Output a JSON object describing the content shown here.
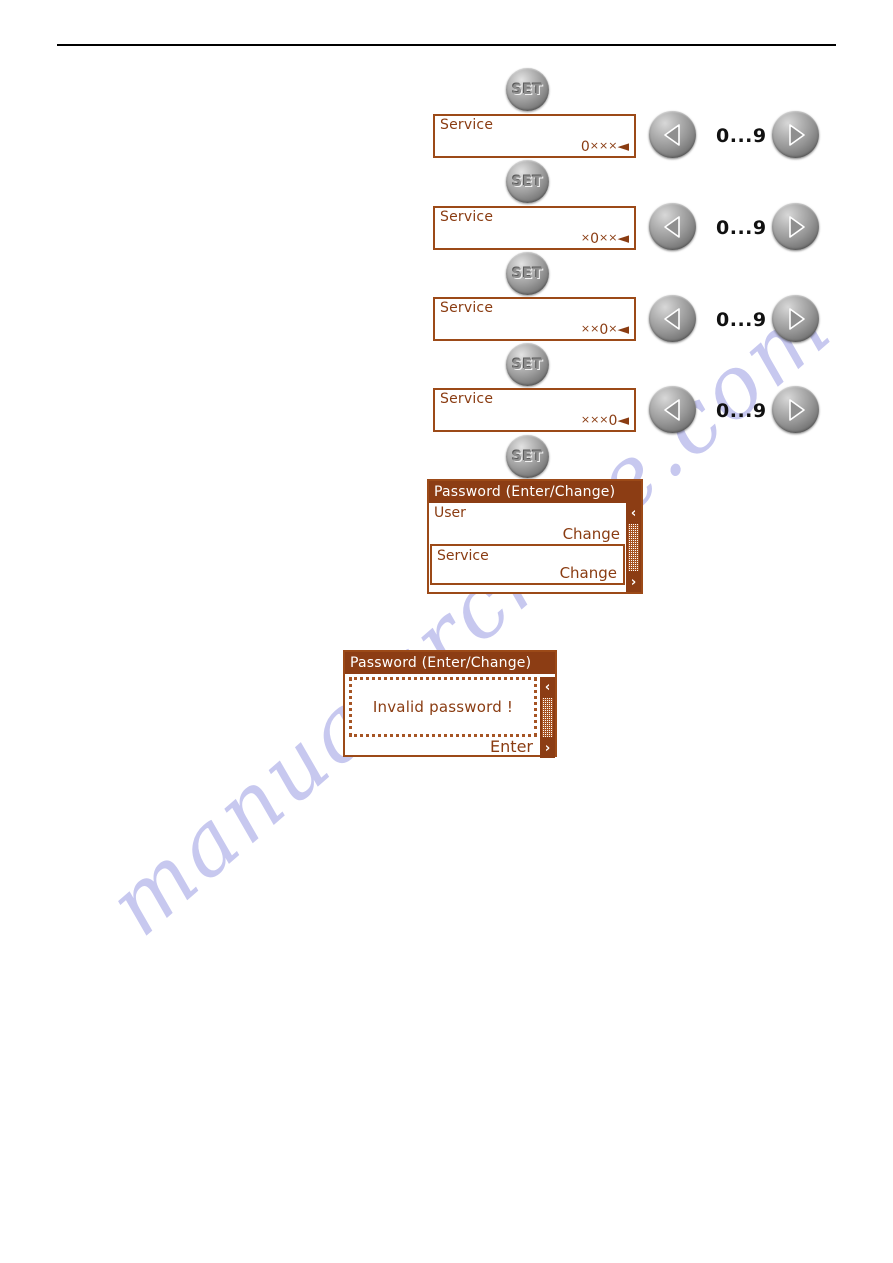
{
  "page": {
    "watermark": "manualarchive.com",
    "rule_color": "#000000"
  },
  "colors": {
    "lcd_border": "#9c4a18",
    "lcd_text": "#8a3c12",
    "titlebar_bg": "#8c3d14",
    "titlebar_text": "#ffffff",
    "watermark": "#c7c8ef",
    "button_face": "#949494"
  },
  "set_buttons": [
    {
      "label": "SET",
      "name": "set-button-1"
    },
    {
      "label": "SET",
      "name": "set-button-2"
    },
    {
      "label": "SET",
      "name": "set-button-3"
    },
    {
      "label": "SET",
      "name": "set-button-4"
    },
    {
      "label": "SET",
      "name": "set-button-5"
    }
  ],
  "entry_steps": [
    {
      "title": "Service",
      "mask_prefix": "",
      "mask_digit": "0",
      "mask_suffix": "×××",
      "cursor": "◄",
      "mask_full": "0×××◄",
      "range_label": "0...9",
      "left_button": "left-arrow-button",
      "right_button": "right-arrow-button"
    },
    {
      "title": "Service",
      "mask_prefix": "×",
      "mask_digit": "0",
      "mask_suffix": "××",
      "cursor": "◄",
      "mask_full": "×0××◄",
      "range_label": "0...9",
      "left_button": "left-arrow-button",
      "right_button": "right-arrow-button"
    },
    {
      "title": "Service",
      "mask_prefix": "××",
      "mask_digit": "0",
      "mask_suffix": "×",
      "cursor": "◄",
      "mask_full": "××0×◄",
      "range_label": "0...9",
      "left_button": "left-arrow-button",
      "right_button": "right-arrow-button"
    },
    {
      "title": "Service",
      "mask_prefix": "×××",
      "mask_digit": "0",
      "mask_suffix": "",
      "cursor": "◄",
      "mask_full": "×××0◄",
      "range_label": "0...9",
      "left_button": "left-arrow-button",
      "right_button": "right-arrow-button"
    }
  ],
  "password_menu": {
    "title": "Password (Enter/Change)",
    "scroll_up": "‹",
    "scroll_down": "›",
    "rows": [
      {
        "label": "User",
        "action": "Change"
      },
      {
        "label": "Service",
        "action": "Change"
      }
    ]
  },
  "invalid_dialog": {
    "title": "Password (Enter/Change)",
    "message": "Invalid password !",
    "action": "Enter",
    "scroll_up": "‹",
    "scroll_down": "›"
  }
}
